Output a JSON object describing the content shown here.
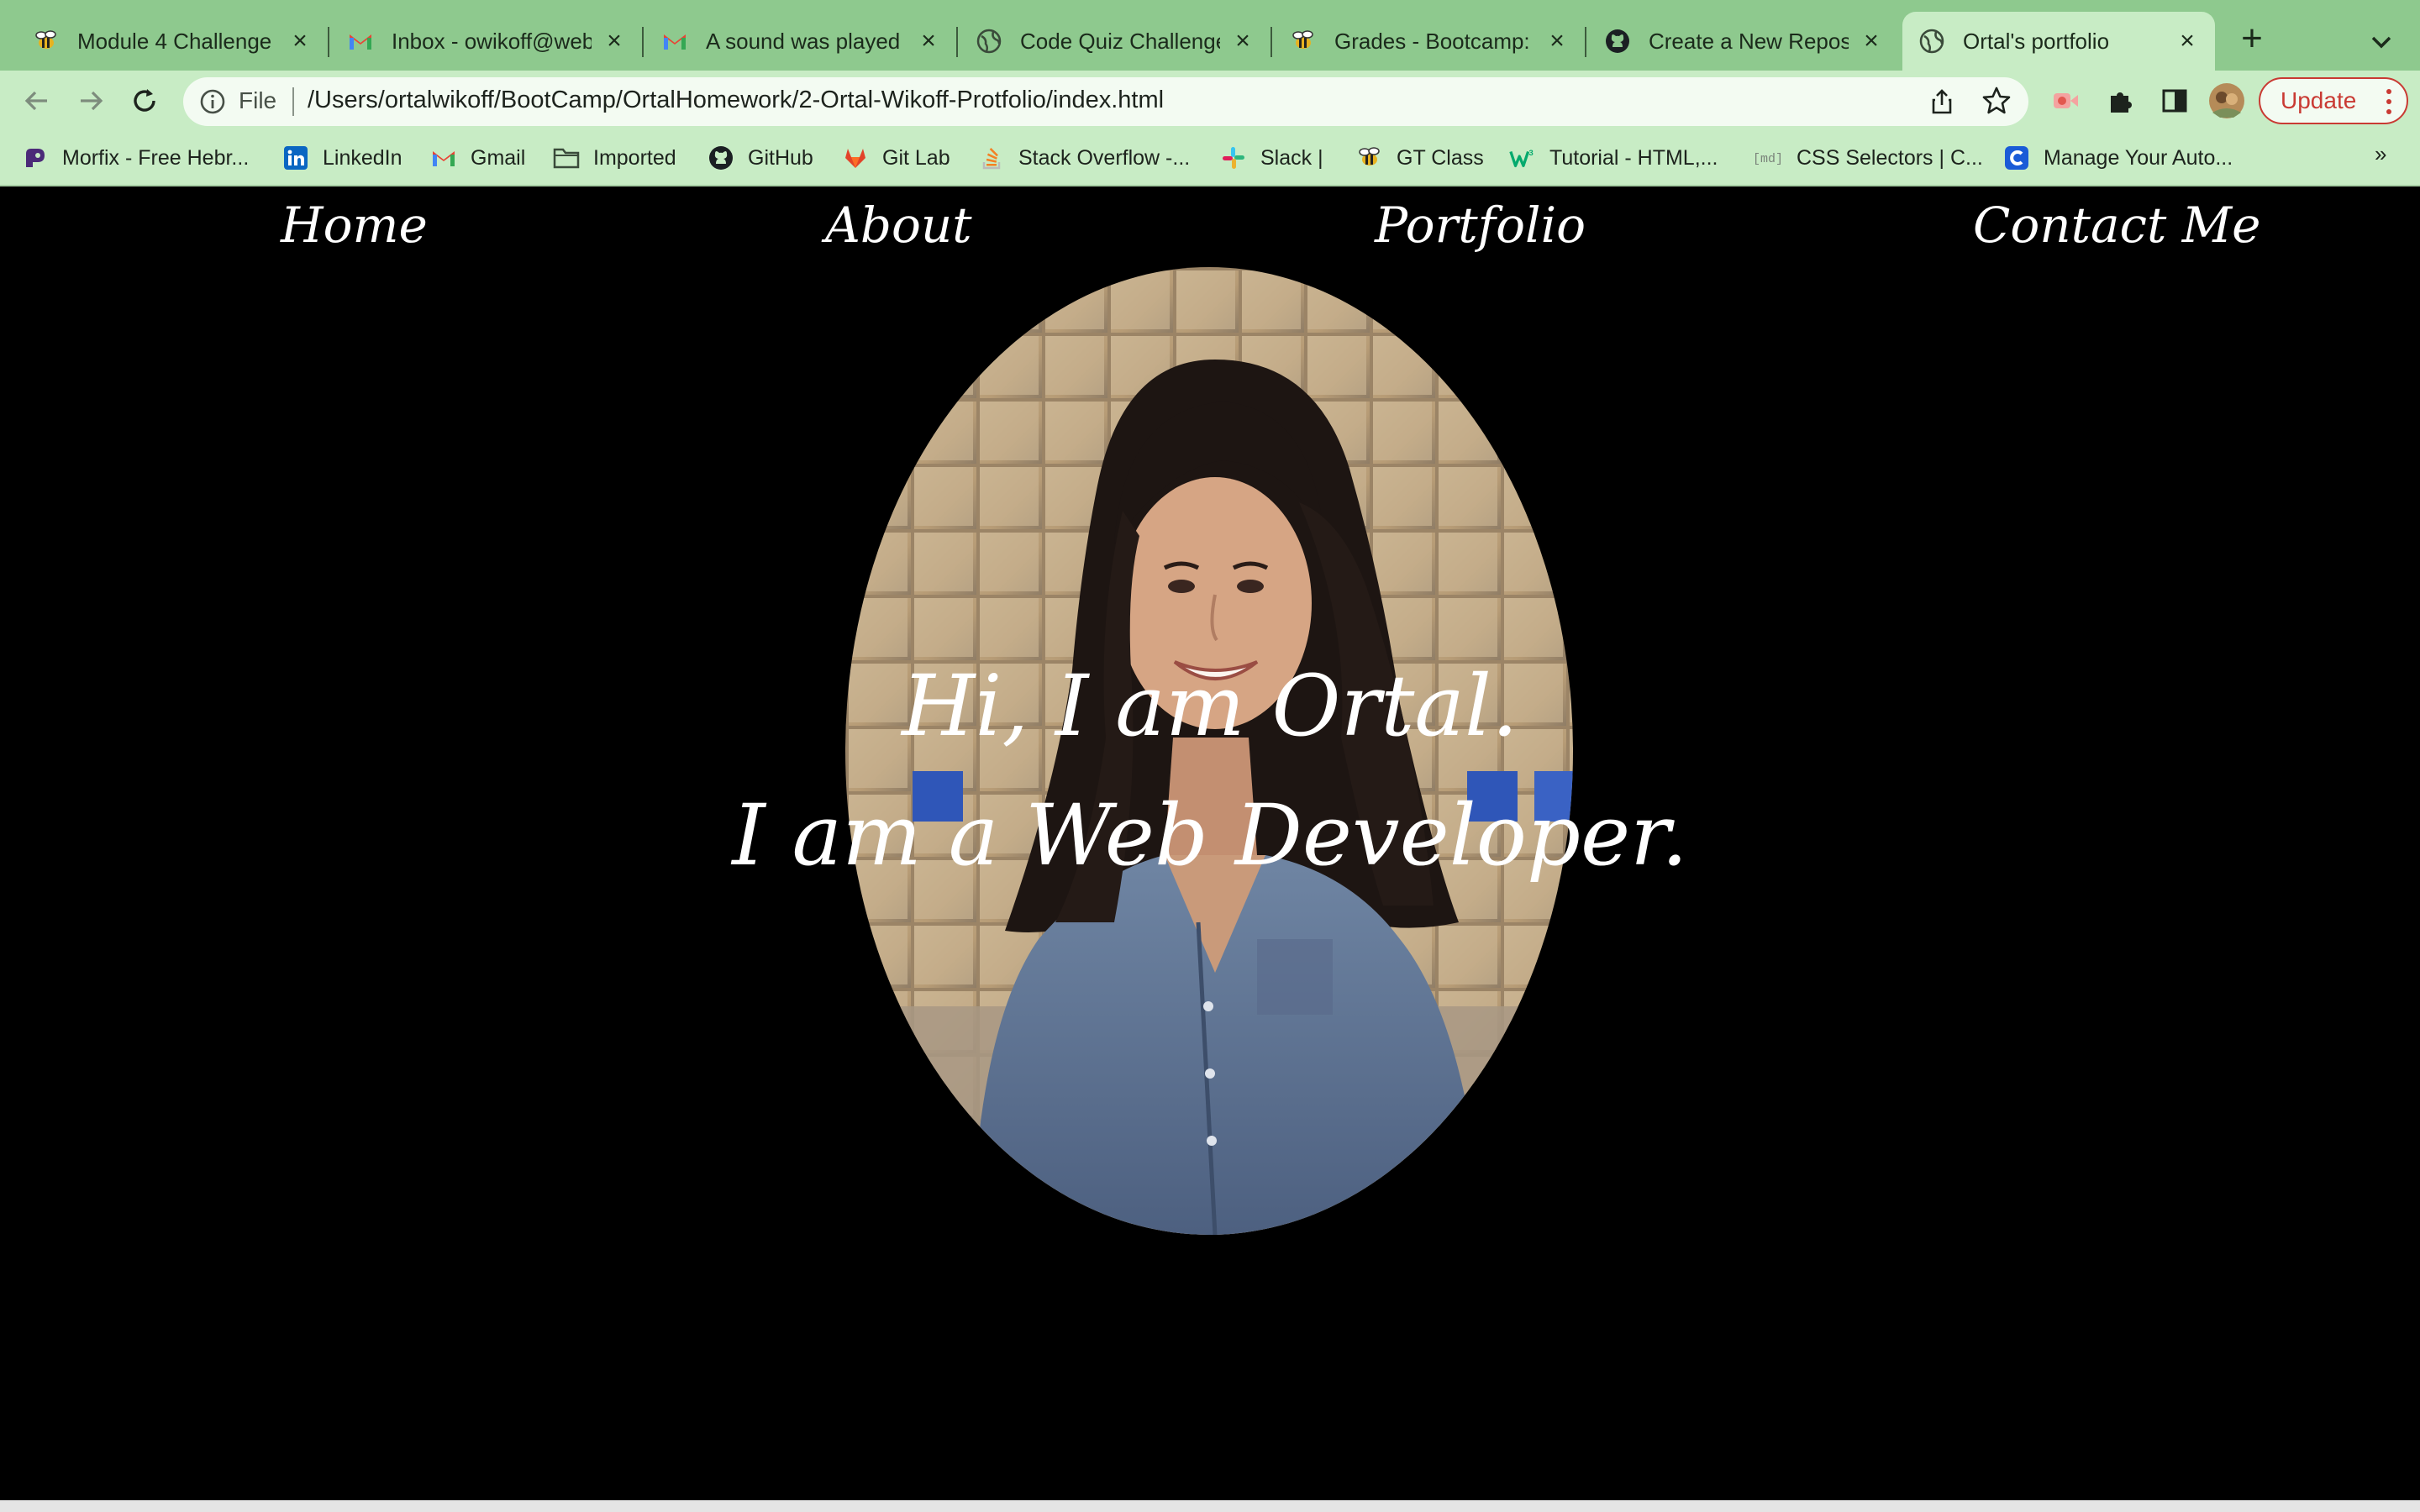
{
  "browser": {
    "tabs": [
      {
        "title": "Module 4 Challenge",
        "icon": "bootcamp-bee-icon"
      },
      {
        "title": "Inbox - owikoff@webe",
        "icon": "gmail-icon"
      },
      {
        "title": "A sound was played o",
        "icon": "gmail-icon"
      },
      {
        "title": "Code Quiz Challenge",
        "icon": "globe-icon"
      },
      {
        "title": "Grades - Bootcamp: G",
        "icon": "bootcamp-bee-icon"
      },
      {
        "title": "Create a New Reposit",
        "icon": "github-icon"
      },
      {
        "title": "Ortal's portfolio",
        "icon": "globe-icon",
        "active": true
      }
    ],
    "address": {
      "scheme_label": "File",
      "url": "/Users/ortalwikoff/BootCamp/OrtalHomework/2-Ortal-Wikoff-Protfolio/index.html"
    },
    "update_label": "Update",
    "bookmarks": [
      {
        "label": "Morfix - Free Hebr...",
        "icon": "morfix-icon"
      },
      {
        "label": "LinkedIn",
        "icon": "linkedin-icon"
      },
      {
        "label": "Gmail",
        "icon": "gmail-icon"
      },
      {
        "label": "Imported",
        "icon": "folder-icon"
      },
      {
        "label": "GitHub",
        "icon": "github-icon"
      },
      {
        "label": "Git Lab",
        "icon": "gitlab-icon"
      },
      {
        "label": "Stack Overflow -...",
        "icon": "stackoverflow-icon"
      },
      {
        "label": "Slack |",
        "icon": "slack-icon"
      },
      {
        "label": "GT Class",
        "icon": "bootcamp-bee-icon"
      },
      {
        "label": "Tutorial - HTML,...",
        "icon": "w3schools-icon"
      },
      {
        "label": "CSS Selectors | C...",
        "icon": "md-icon"
      },
      {
        "label": "Manage Your Auto...",
        "icon": "c-icon"
      }
    ],
    "overflow_label": "»"
  },
  "page": {
    "nav": [
      "Home",
      "About",
      "Portfolio",
      "Contact Me"
    ],
    "hero": {
      "line1": "Hi, I am Ortal.",
      "line2": "I am a Web Developer."
    }
  },
  "colors": {
    "tabstrip": "#8ec98e",
    "toolbar": "#c8ecc5",
    "page_bg": "#000000",
    "page_text": "#ffffff",
    "update": "#c93a33"
  }
}
